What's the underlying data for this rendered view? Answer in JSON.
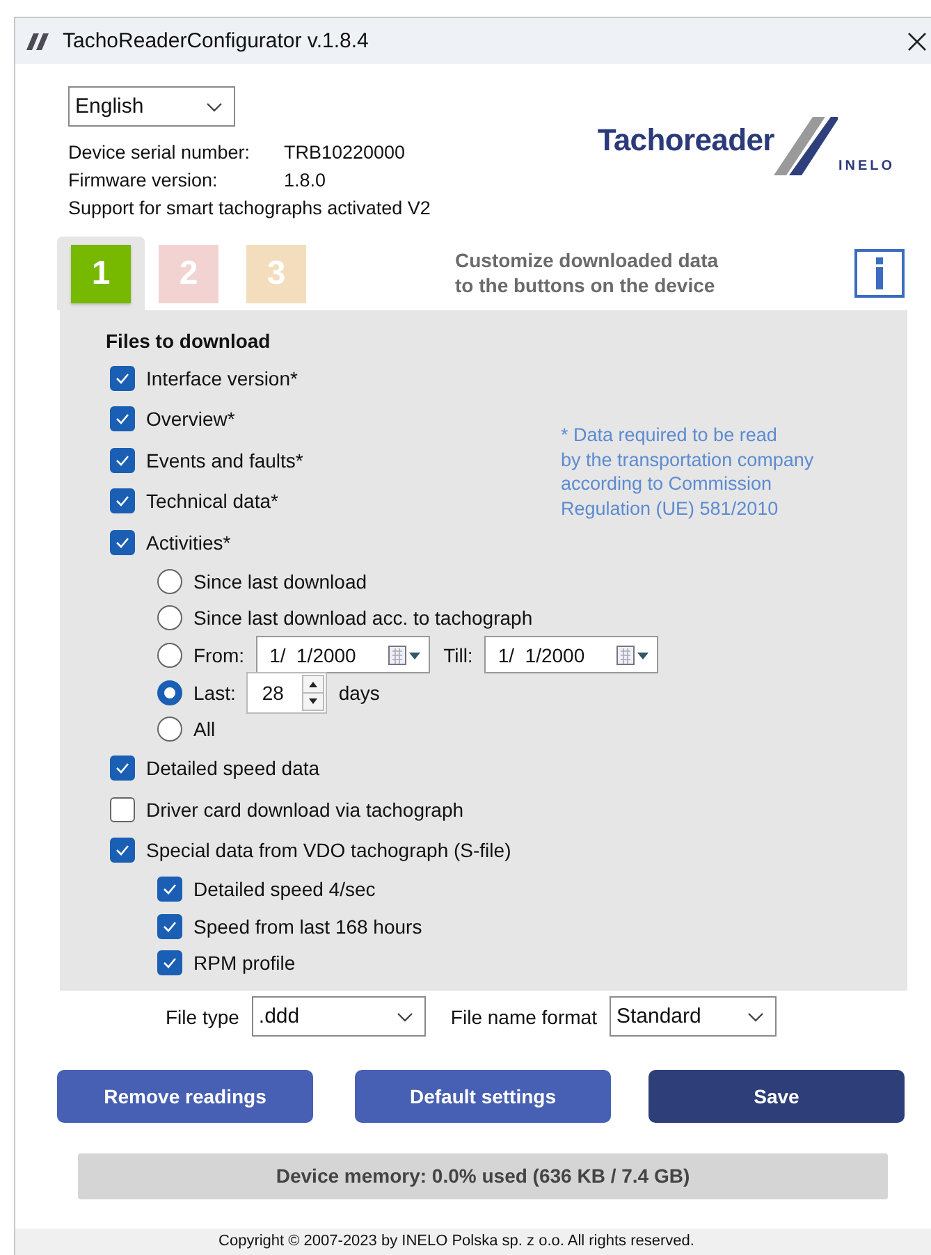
{
  "window": {
    "title": "TachoReaderConfigurator v.1.8.4"
  },
  "language": {
    "value": "English"
  },
  "device_info": [
    {
      "label": "Device serial number:",
      "value": "TRB10220000"
    },
    {
      "label": "Firmware version:",
      "value": "1.8.0"
    }
  ],
  "support_note": "Support for smart tachographs activated V2",
  "logo": {
    "text": "Tachoreader",
    "subtext": "INELO"
  },
  "tabs": [
    {
      "label": "1",
      "selected": true,
      "color": "#77b800"
    },
    {
      "label": "2",
      "selected": false,
      "color": "#f2d3d1"
    },
    {
      "label": "3",
      "selected": false,
      "color": "#f3ddbd"
    }
  ],
  "tabs_hint": "Customize downloaded data\nto the buttons on the device",
  "files_heading": "Files to download",
  "required_note": "* Data required to be read\nby the transportation company\naccording to Commission\nRegulation (UE) 581/2010",
  "options": [
    {
      "kind": "checkbox",
      "label": "Interface version*",
      "checked": true
    },
    {
      "kind": "checkbox",
      "label": "Overview*",
      "checked": true
    },
    {
      "kind": "checkbox",
      "label": "Events and faults*",
      "checked": true
    },
    {
      "kind": "checkbox",
      "label": "Technical data*",
      "checked": true
    },
    {
      "kind": "checkbox",
      "label": "Activities*",
      "checked": true,
      "children": [
        {
          "kind": "radio",
          "label": "Since last download",
          "selected": false
        },
        {
          "kind": "radio",
          "label": "Since last download acc. to tachograph",
          "selected": false
        },
        {
          "kind": "radio_range",
          "label": "From:",
          "selected": false,
          "from": "1/  1/2000",
          "till_label": "Till:",
          "till": "1/  1/2000"
        },
        {
          "kind": "radio_days",
          "label": "Last:",
          "selected": true,
          "value": "28",
          "unit": "days"
        },
        {
          "kind": "radio",
          "label": "All",
          "selected": false
        }
      ]
    },
    {
      "kind": "checkbox",
      "label": "Detailed speed data",
      "checked": true
    },
    {
      "kind": "checkbox",
      "label": "Driver card download via tachograph",
      "checked": false
    },
    {
      "kind": "checkbox",
      "label": "Special data from VDO tachograph (S-file)",
      "checked": true,
      "children": [
        {
          "kind": "checkbox",
          "label": "Detailed speed 4/sec",
          "checked": true
        },
        {
          "kind": "checkbox",
          "label": "Speed from last 168 hours",
          "checked": true
        },
        {
          "kind": "checkbox",
          "label": "RPM profile",
          "checked": true
        }
      ]
    }
  ],
  "file_type": {
    "label": "File type",
    "value": ".ddd"
  },
  "file_name_format": {
    "label": "File name format",
    "value": "Standard"
  },
  "buttons": [
    {
      "label": "Remove readings",
      "kind": "secondary"
    },
    {
      "label": "Default settings",
      "kind": "secondary"
    },
    {
      "label": "Save",
      "kind": "primary"
    }
  ],
  "memory": {
    "text": "Device memory: 0.0% used (636 KB / 7.4 GB)"
  },
  "copyright": "Copyright © 2007-2023 by INELO Polska sp. z o.o. All rights reserved."
}
